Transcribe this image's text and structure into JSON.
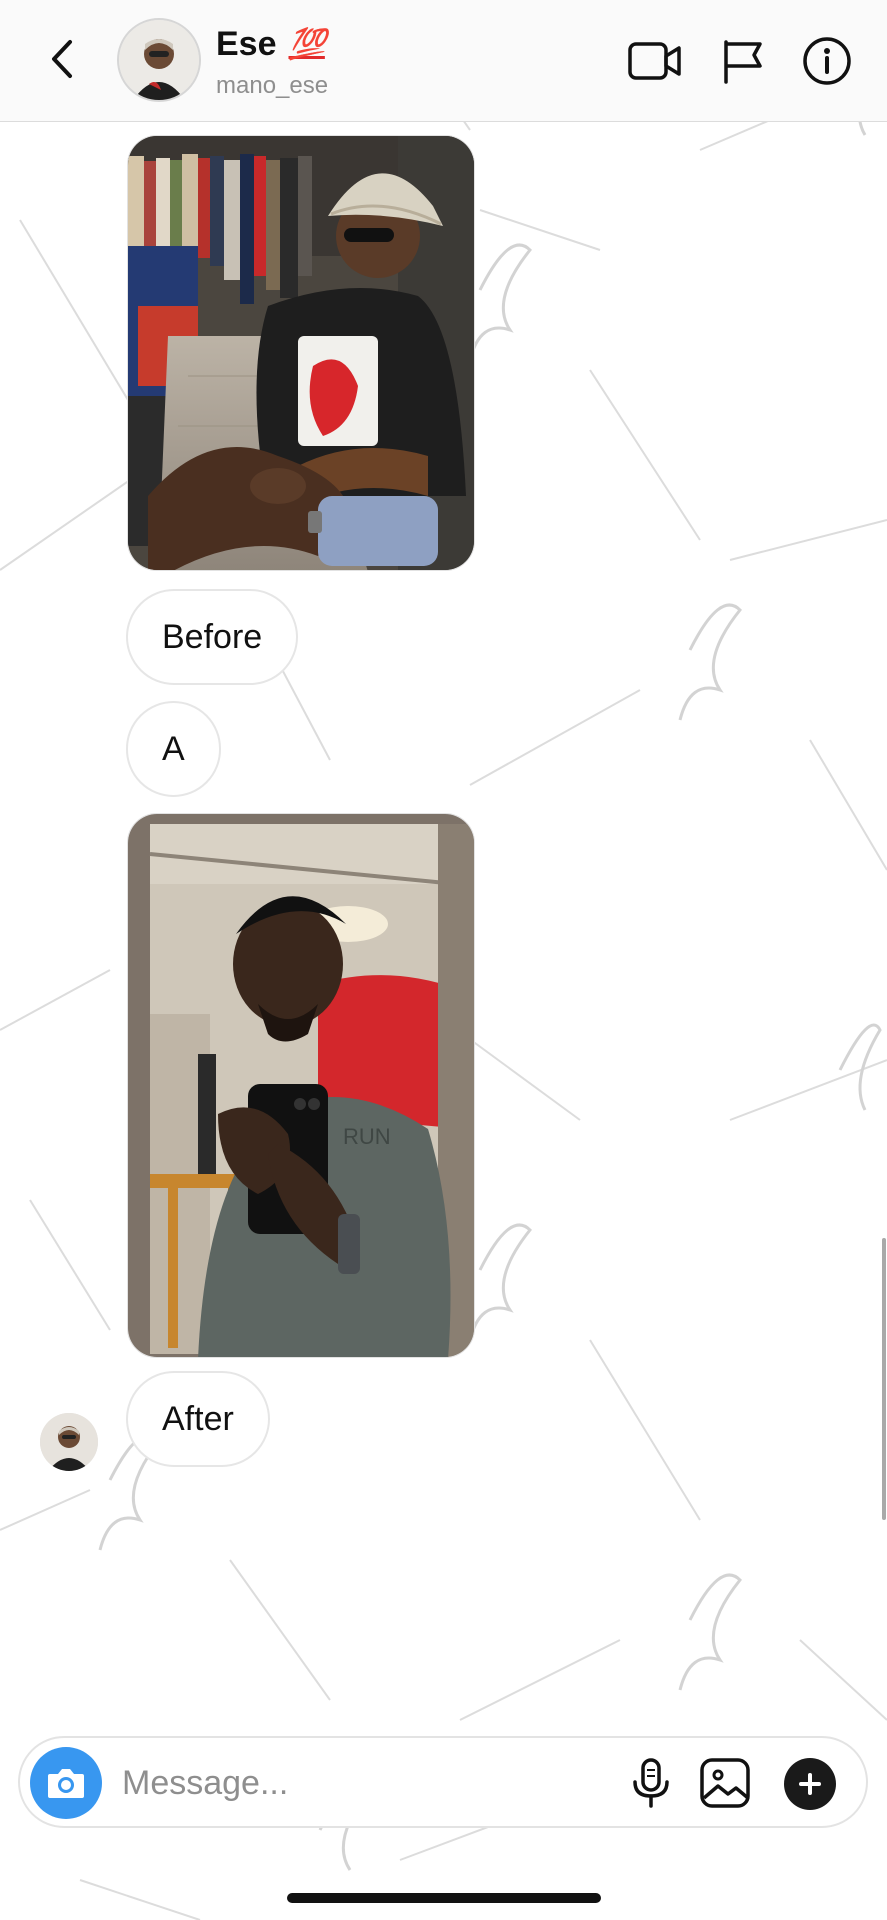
{
  "header": {
    "name": "Ese",
    "badge": "💯",
    "username": "mano_ese",
    "icons": [
      "back-arrow-icon",
      "video-call-icon",
      "flag-icon",
      "info-icon"
    ]
  },
  "messages": [
    {
      "type": "photo",
      "description_icon": "photo-shop-icon"
    },
    {
      "type": "text",
      "text": "Before"
    },
    {
      "type": "text",
      "text": "A"
    },
    {
      "type": "photo",
      "description_icon": "photo-selfie-icon"
    },
    {
      "type": "text",
      "text": "After"
    }
  ],
  "composer": {
    "placeholder": "Message...",
    "icons": [
      "camera-icon",
      "microphone-icon",
      "gallery-icon",
      "plus-icon"
    ]
  },
  "colors": {
    "accent": "#3897f0",
    "badge": "#e12a2a",
    "secondary_text": "#8e8e8e",
    "bubble_border": "#e6e6e6"
  }
}
